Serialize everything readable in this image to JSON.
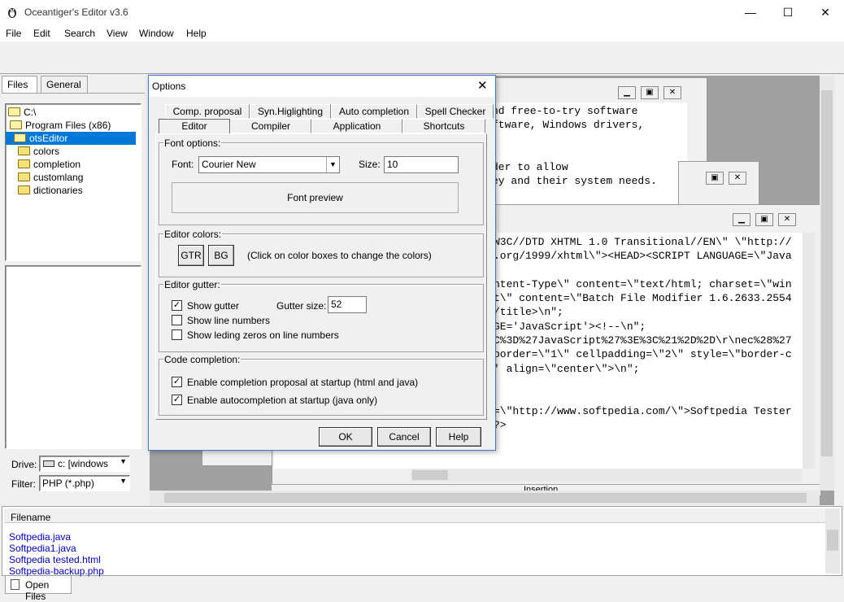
{
  "window": {
    "title": "Oceantiger's Editor v3.6",
    "min": "—",
    "max": "☐",
    "close": "✕"
  },
  "menu": [
    "File",
    "Edit",
    "Search",
    "View",
    "Window",
    "Help"
  ],
  "left_tabs": [
    "Files",
    "General"
  ],
  "tree": [
    "C:\\",
    "Program Files (x86)",
    "otsEditor",
    "colors",
    "completion",
    "customlang",
    "dictionaries"
  ],
  "drive": {
    "label": "Drive:",
    "value": "c: [windows"
  },
  "filter": {
    "label": "Filter:",
    "value": "PHP (*.php)"
  },
  "dialog": {
    "title": "Options",
    "tabs_row1": [
      "Comp. proposal",
      "Syn.Higlighting",
      "Auto completion",
      "Spell Checker"
    ],
    "tabs_row2": [
      "Editor",
      "Compiler",
      "Application",
      "Shortcuts"
    ],
    "font_options": {
      "group": "Font options:",
      "font_label": "Font:",
      "font_value": "Courier New",
      "size_label": "Size:",
      "size_value": "10",
      "preview": "Font preview"
    },
    "editor_colors": {
      "group": "Editor colors:",
      "gtr": "GTR",
      "bg": "BG",
      "hint": "(Click on color boxes to change the colors)"
    },
    "gutter": {
      "group": "Editor gutter:",
      "show_gutter": "Show gutter",
      "gutter_size_label": "Gutter size:",
      "gutter_size_value": "52",
      "show_line_numbers": "Show line numbers",
      "show_leading_zeros": "Show leding zeros on line numbers"
    },
    "completion": {
      "group": "Code completion:",
      "enable_proposal": "Enable completion proposal at startup (html and java)",
      "enable_auto": "Enable autocompletion at startup (java only)"
    },
    "buttons": {
      "ok": "OK",
      "cancel": "Cancel",
      "help": "Help"
    }
  },
  "code_top": [
    "nd free-to-try software",
    "ftware, Windows drivers,",
    "",
    "",
    "der to allow",
    "ey and their system needs."
  ],
  "code_main": [
    "W3C//DTD XHTML 1.0 Transitional//EN\\\" \\\"http://",
    ".org/1999/xhtml\\\"><HEAD><SCRIPT LANGUAGE=\\\"Java",
    "",
    "ntent-Type\\\" content=\\\"text/html; charset=\\\"win",
    "t\\\" content=\\\"Batch File Modifier 1.6.2633.2554",
    "/title>\\n\";",
    "GE='JavaScript'><!--\\n\";",
    "C%3D%27JavaScript%27%3E%3C%21%2D%2D\\r\\nec%28%27",
    "border=\\\"1\\\" cellpadding=\\\"2\\\" style=\\\"border-c",
    "' align=\\\"center\\\">\\n\";",
    "",
    "",
    "=\\\"http://www.softpedia.com/\\\">Softpedia Tester",
    "?>"
  ],
  "status_partial": "Insertion",
  "bottom": {
    "header": "Filename",
    "files": [
      "Softpedia.java",
      "Softpedia1.java",
      "Softpedia tested.html",
      "Softpedia-backup.php"
    ],
    "tab": "Open Files"
  }
}
